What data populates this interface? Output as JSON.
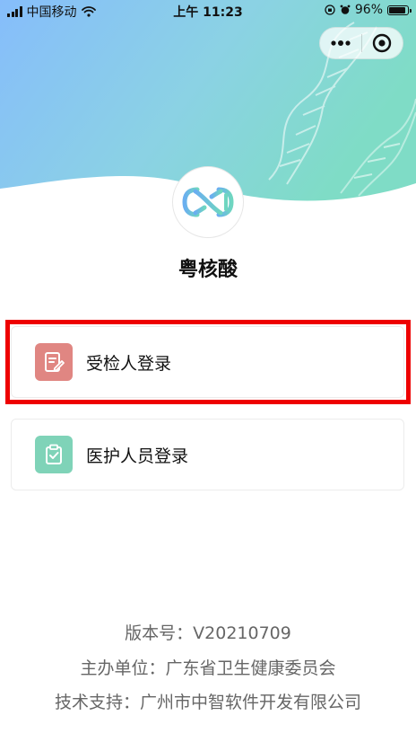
{
  "status_bar": {
    "carrier": "中国移动",
    "time": "上午 11:23",
    "battery": "96%",
    "battery_level": 0.96
  },
  "app": {
    "name": "粤核酸"
  },
  "login_options": [
    {
      "label": "受检人登录",
      "icon": "edit-document-icon",
      "color": "#e08682"
    },
    {
      "label": "医护人员登录",
      "icon": "clipboard-check-icon",
      "color": "#7fd3b8"
    }
  ],
  "footer": {
    "version": "版本号：V20210709",
    "sponsor": "主办单位：广东省卫生健康委员会",
    "support": "技术支持：广州市中智软件开发有限公司"
  },
  "colors": {
    "hero_start": "#84c2ff",
    "hero_end": "#7fd6c6",
    "highlight": "#ee0000",
    "footer_text": "#666666"
  }
}
